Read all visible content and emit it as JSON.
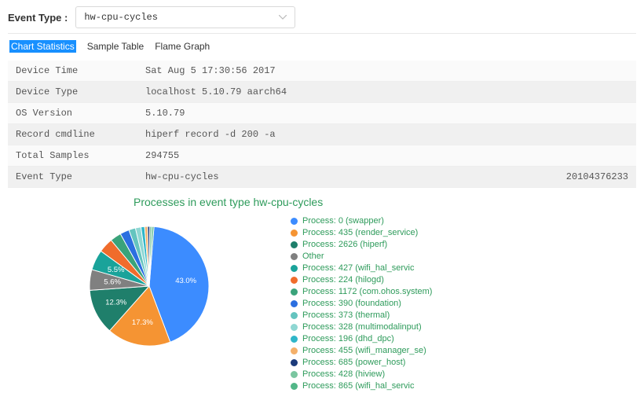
{
  "topbar": {
    "label": "Event Type :",
    "selected": "hw-cpu-cycles"
  },
  "tabs": [
    {
      "label": "Chart Statistics",
      "active": true
    },
    {
      "label": "Sample Table",
      "active": false
    },
    {
      "label": "Flame Graph",
      "active": false
    }
  ],
  "info": [
    {
      "label": "Device Time",
      "value": "Sat Aug 5 17:30:56 2017",
      "num": ""
    },
    {
      "label": "Device Type",
      "value": "localhost 5.10.79 aarch64",
      "num": ""
    },
    {
      "label": "OS Version",
      "value": "5.10.79",
      "num": ""
    },
    {
      "label": "Record cmdline",
      "value": "hiperf record -d 200 -a",
      "num": ""
    },
    {
      "label": "Total Samples",
      "value": "294755",
      "num": ""
    },
    {
      "label": "Event Type",
      "value": "hw-cpu-cycles",
      "num": "20104376233"
    }
  ],
  "chart_title": "Processes in event type hw-cpu-cycles",
  "chart_data": {
    "type": "pie",
    "title": "Processes in event type hw-cpu-cycles",
    "series": [
      {
        "name": "Process: 0 (swapper)",
        "value": 43.0,
        "color": "#3c8cff",
        "labeled": true
      },
      {
        "name": "Process: 435 (render_service)",
        "value": 17.3,
        "color": "#f59433",
        "labeled": true
      },
      {
        "name": "Process: 2626 (hiperf)",
        "value": 12.3,
        "color": "#1f7f6b",
        "labeled": true
      },
      {
        "name": "Other",
        "value": 5.6,
        "color": "#808080",
        "labeled": true
      },
      {
        "name": "Process: 427 (wifi_hal_servic",
        "value": 5.5,
        "color": "#1aa39a",
        "labeled": true
      },
      {
        "name": "Process: 224 (hilogd)",
        "value": 4.0,
        "color": "#f06c2c",
        "labeled": false
      },
      {
        "name": "Process: 1172 (com.ohos.system)",
        "value": 3.0,
        "color": "#3aa37a",
        "labeled": false
      },
      {
        "name": "Process: 390 (foundation)",
        "value": 2.5,
        "color": "#2b6fe0",
        "labeled": false
      },
      {
        "name": "Process: 373 (thermal)",
        "value": 1.8,
        "color": "#64c4bf",
        "labeled": false
      },
      {
        "name": "Process: 328 (multimodalinput)",
        "value": 1.5,
        "color": "#8fd7d3",
        "labeled": false
      },
      {
        "name": "Process: 196 (dhd_dpc)",
        "value": 1.0,
        "color": "#2fb6c9",
        "labeled": false
      },
      {
        "name": "Process: 455 (wifi_manager_se)",
        "value": 0.8,
        "color": "#f4b06a",
        "labeled": false
      },
      {
        "name": "Process: 685 (power_host)",
        "value": 0.6,
        "color": "#1b3a7a",
        "labeled": false
      },
      {
        "name": "Process: 428 (hiview)",
        "value": 0.6,
        "color": "#7ac6a0",
        "labeled": false
      },
      {
        "name": "Process: 865 (wifi_hal_servic",
        "value": 0.5,
        "color": "#52b788",
        "labeled": false
      }
    ]
  }
}
